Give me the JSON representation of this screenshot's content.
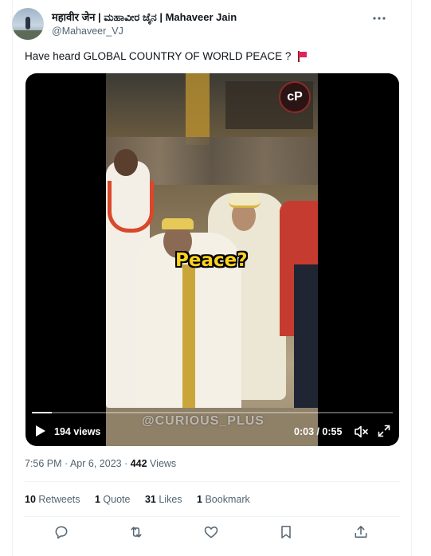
{
  "author": {
    "display_name": "महावीर जेन | ಮಹಾವೀರ ಜೈನ | Mahaveer Jain",
    "handle": "@Mahaveer_VJ"
  },
  "tweet": {
    "text": "Have heard GLOBAL COUNTRY OF WORLD PEACE ?"
  },
  "video": {
    "caption": "Peace?",
    "watermark": "@CURIOUS_PLUS",
    "channel_logo": "cP",
    "views_label": "194 views",
    "time_label": "0:03 / 0:55",
    "progress": 0.055
  },
  "meta": {
    "timestamp": "7:56 PM · Apr 6, 2023 · ",
    "view_count": "442",
    "views_label": " Views"
  },
  "stats": [
    {
      "count": "10",
      "label": "Retweets"
    },
    {
      "count": "1",
      "label": "Quote"
    },
    {
      "count": "31",
      "label": "Likes"
    },
    {
      "count": "1",
      "label": "Bookmark"
    }
  ],
  "icons": {
    "more": "more-horizontal-icon",
    "flag": "red-flag-icon",
    "play": "play-icon",
    "mute": "volume-muted-icon",
    "fullscreen": "fullscreen-icon",
    "reply": "reply-icon",
    "retweet": "retweet-icon",
    "like": "like-icon",
    "bookmark": "bookmark-icon",
    "share": "share-icon"
  },
  "colors": {
    "text_primary": "#0f1419",
    "text_secondary": "#536471",
    "caption_yellow": "#ffd21f",
    "flag_red": "#e0245e"
  }
}
